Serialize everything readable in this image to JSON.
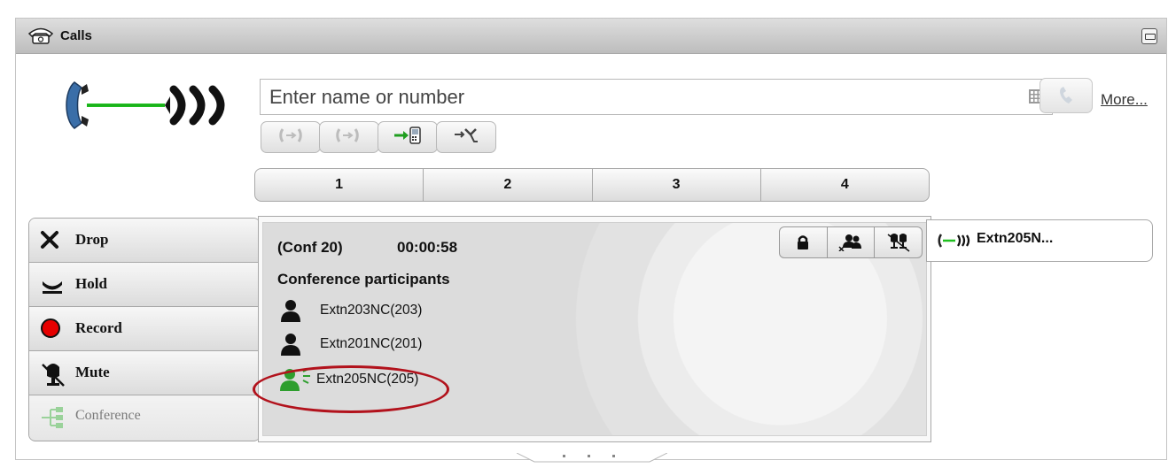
{
  "window": {
    "title": "Calls",
    "minimize_icon": "minimize-icon"
  },
  "logo_icon": "phone-connected-icon",
  "dialer": {
    "placeholder": "Enter name or number",
    "keypad_icon": "keypad-icon",
    "call_icon": "phone-handset-icon",
    "more_label": "More...",
    "call_buttons": [
      {
        "name": "pickup-icon",
        "enabled": false
      },
      {
        "name": "transfer-icon",
        "enabled": false
      },
      {
        "name": "transfer-to-mobile-icon",
        "enabled": true
      },
      {
        "name": "park-icon",
        "enabled": true
      }
    ]
  },
  "tabs": [
    "1",
    "2",
    "3",
    "4"
  ],
  "actions": [
    {
      "label": "Drop",
      "icon": "x-icon",
      "enabled": true
    },
    {
      "label": "Hold",
      "icon": "hold-icon",
      "enabled": true
    },
    {
      "label": "Record",
      "icon": "record-icon",
      "enabled": true
    },
    {
      "label": "Mute",
      "icon": "mute-icon",
      "enabled": true
    },
    {
      "label": "Conference",
      "icon": "conference-icon",
      "enabled": false
    }
  ],
  "conference": {
    "id": "(Conf 20)",
    "timer": "00:00:58",
    "heading": "Conference participants",
    "tools": [
      "lock-icon",
      "remove-participant-icon",
      "mute-all-icon"
    ],
    "participants": [
      {
        "name": "Extn203NC(203)",
        "speaking": false
      },
      {
        "name": "Extn201NC(201)",
        "speaking": false
      },
      {
        "name": "Extn205NC(205)",
        "speaking": true
      }
    ],
    "highlight_color": "#b2121c",
    "speaking_color": "#2e9e2e"
  },
  "active_call": {
    "name": "Extn205N...",
    "icon": "call-connected-icon"
  },
  "colors": {
    "accent_green": "#1fbf1f",
    "handset_blue": "#3a6ea8"
  }
}
